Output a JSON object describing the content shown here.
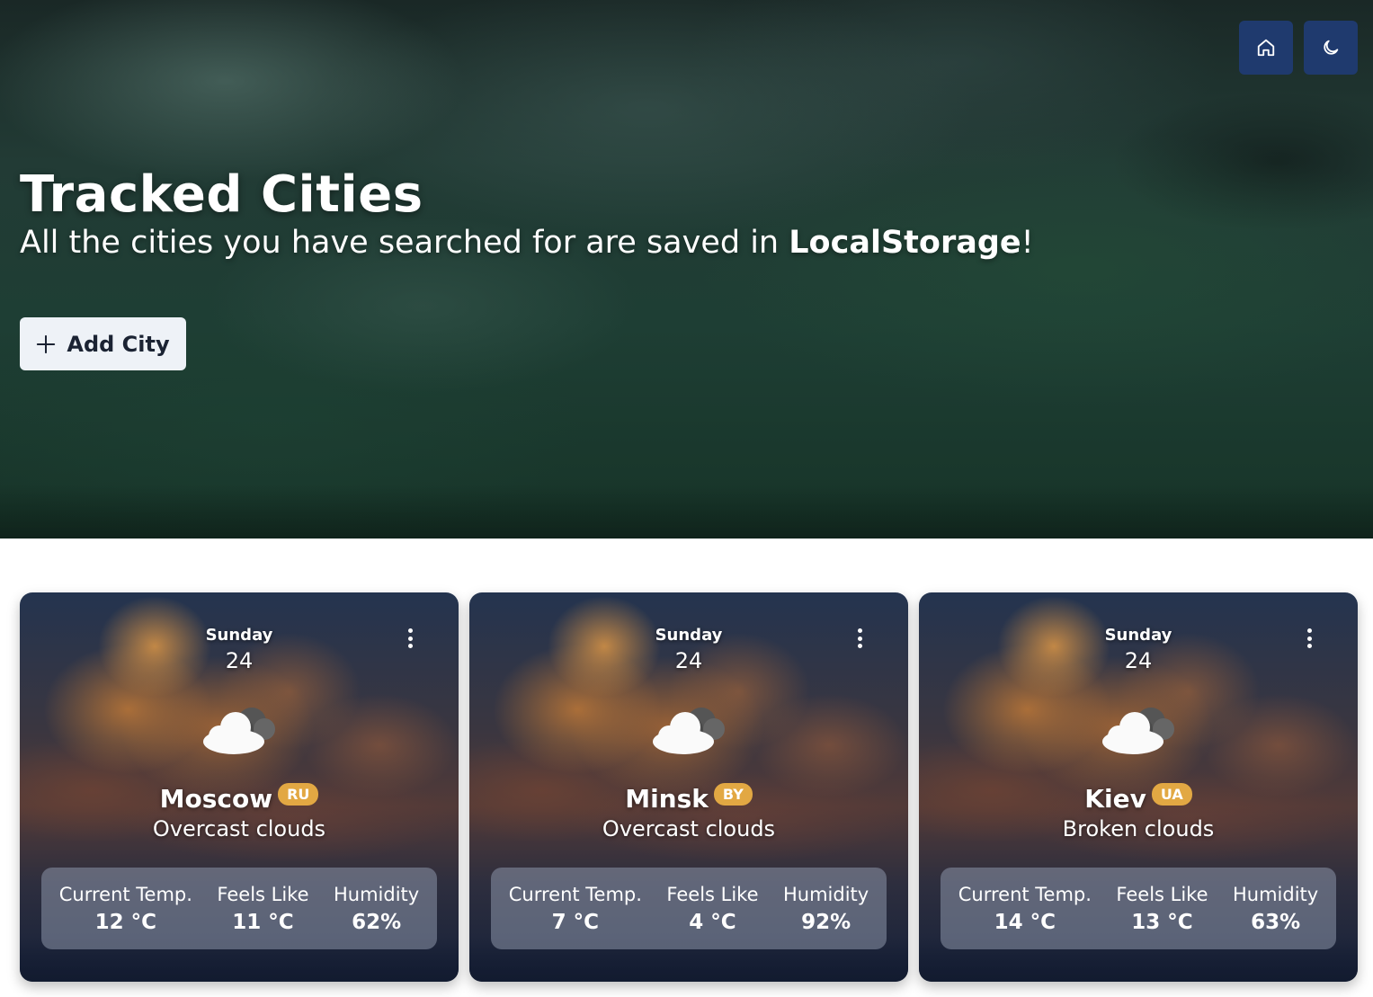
{
  "header": {
    "home_icon": "home-icon",
    "theme_icon": "moon-icon"
  },
  "hero": {
    "title": "Tracked Cities",
    "subtitle_prefix": "All the cities you have searched for are saved in ",
    "subtitle_bold": "LocalStorage",
    "subtitle_suffix": "!",
    "add_button_label": "Add City",
    "add_button_icon": "plus-icon"
  },
  "labels": {
    "current_temp": "Current Temp.",
    "feels_like": "Feels Like",
    "humidity": "Humidity"
  },
  "cards": [
    {
      "day": "Sunday",
      "date": "24",
      "weather_icon": "cloud-icon",
      "city": "Moscow",
      "country": "RU",
      "description": "Overcast clouds",
      "current_temp": "12 °C",
      "feels_like": "11 °C",
      "humidity": "62%"
    },
    {
      "day": "Sunday",
      "date": "24",
      "weather_icon": "cloud-icon",
      "city": "Minsk",
      "country": "BY",
      "description": "Overcast clouds",
      "current_temp": "7 °C",
      "feels_like": "4 °C",
      "humidity": "92%"
    },
    {
      "day": "Sunday",
      "date": "24",
      "weather_icon": "cloud-icon",
      "city": "Kiev",
      "country": "UA",
      "description": "Broken clouds",
      "current_temp": "14 °C",
      "feels_like": "13 °C",
      "humidity": "63%"
    }
  ],
  "colors": {
    "nav_button": "#1f3a6e",
    "badge": "#e2a843",
    "add_button_bg": "#eef2f7"
  }
}
